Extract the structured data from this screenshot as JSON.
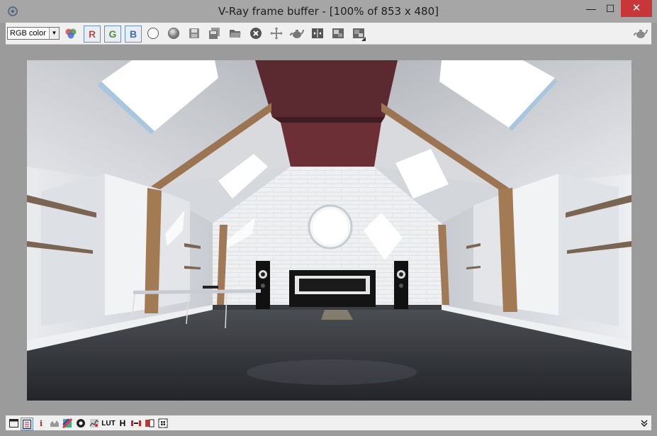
{
  "window": {
    "title": "V-Ray frame buffer - [100% of 853 x 480]",
    "minimize": "—",
    "maximize": "☐",
    "close": "✕"
  },
  "toolbar": {
    "channel_value": "RGB color",
    "red_label": "R",
    "green_label": "G",
    "blue_label": "B",
    "red_color": "#b5524a",
    "green_color": "#5b8a3d",
    "blue_color": "#4a6a9a",
    "icons": [
      "color-channels-icon",
      "mono-white-icon",
      "mono-gray-icon",
      "save-icon",
      "save-all-icon",
      "open-icon",
      "clear-icon",
      "track-mouse-icon",
      "teapot-render-icon",
      "compare-icon",
      "region-a-icon",
      "region-b-icon"
    ]
  },
  "statusbar": {
    "lut_label": "LUT",
    "h_label": "H",
    "info_label": "i"
  }
}
